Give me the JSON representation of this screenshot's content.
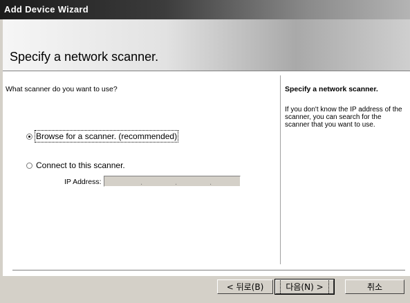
{
  "window": {
    "title": "Add Device Wizard"
  },
  "header": {
    "title": "Specify a network scanner."
  },
  "main": {
    "question": "What scanner do you want to use?",
    "options": [
      {
        "label": "Browse for a scanner. (recommended)",
        "selected": true
      },
      {
        "label": "Connect to this scanner.",
        "selected": false
      }
    ],
    "ip": {
      "label": "IP Address:",
      "value": ""
    }
  },
  "side": {
    "title": "Specify a network scanner.",
    "description": "If you don't know the IP address of the scanner, you can search for the scanner that you want to use."
  },
  "buttons": {
    "back": "< 뒤로(B)",
    "next": "다음(N) >",
    "cancel": "취소"
  }
}
